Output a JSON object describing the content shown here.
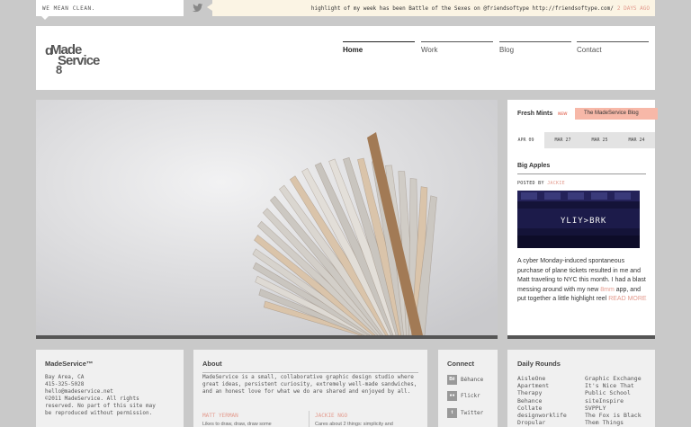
{
  "top": {
    "tagline": "WE MEAN CLEAN.",
    "tweet_text": "highlight of my week has been Battle of the Sexes on @friendsoftype http://friendsoftype.com/",
    "tweet_ago": "2 DAYS AGO"
  },
  "header": {
    "logo_text": "MadeService",
    "nav": [
      "Home",
      "Work",
      "Blog",
      "Contact"
    ]
  },
  "sidebar": {
    "title": "Fresh Mints",
    "title_mark": "NEW",
    "blog_tag": "The MadeService Blog",
    "tabs": [
      "APR 09",
      "MAR 27",
      "MAR 25",
      "MAR 24"
    ],
    "post": {
      "title": "Big Apples",
      "posted_by": "POSTED BY",
      "author": "JACKIE",
      "image_text": "YLIY>BRK",
      "body": "A cyber Monday-induced spontaneous purchase of plane tickets resulted in me and Matt traveling to NYC this month. I had a blast messing around with my new ",
      "body_link": "8mm",
      "body_tail": " app, and put together a little highlight reel ",
      "read_more": "READ MORE"
    }
  },
  "footer": {
    "company": {
      "title": "MadeService™",
      "lines": [
        "Bay Area, CA",
        "415-325-5028",
        "hello@madeservice.net",
        "©2011 MadeService. All rights",
        "reserved. No part of this site may",
        "be reproduced without permission."
      ]
    },
    "about": {
      "title": "About",
      "text": "MadeService is a small, collaborative graphic design studio where great ideas, persistent curiosity, extremely well-made sandwiches, and an honest love for what we do are shared and enjoyed by all.",
      "col1_name": "MATT YERMAN",
      "col1_text": "Likes to draw, draw, draw some",
      "col2_name": "JACKIE NGO",
      "col2_text": "Cares about 2 things: simplicity and"
    },
    "connect": {
      "title": "Connect",
      "items": [
        {
          "label": "Béhance",
          "icon": "behance-icon"
        },
        {
          "label": "Flickr",
          "icon": "flickr-icon"
        },
        {
          "label": "Twitter",
          "icon": "twitter-icon"
        }
      ]
    },
    "rounds": {
      "title": "Daily Rounds",
      "col1": [
        "AisleOne",
        "Apartment",
        "Therapy",
        "Behance",
        "Collate",
        "designworklife",
        "Dropular"
      ],
      "col2": [
        "Graphic Exchange",
        "It's Nice That",
        "Public School",
        "siteInspire",
        "SVPPLY",
        "The Fox is Black",
        "Them Things"
      ]
    }
  }
}
